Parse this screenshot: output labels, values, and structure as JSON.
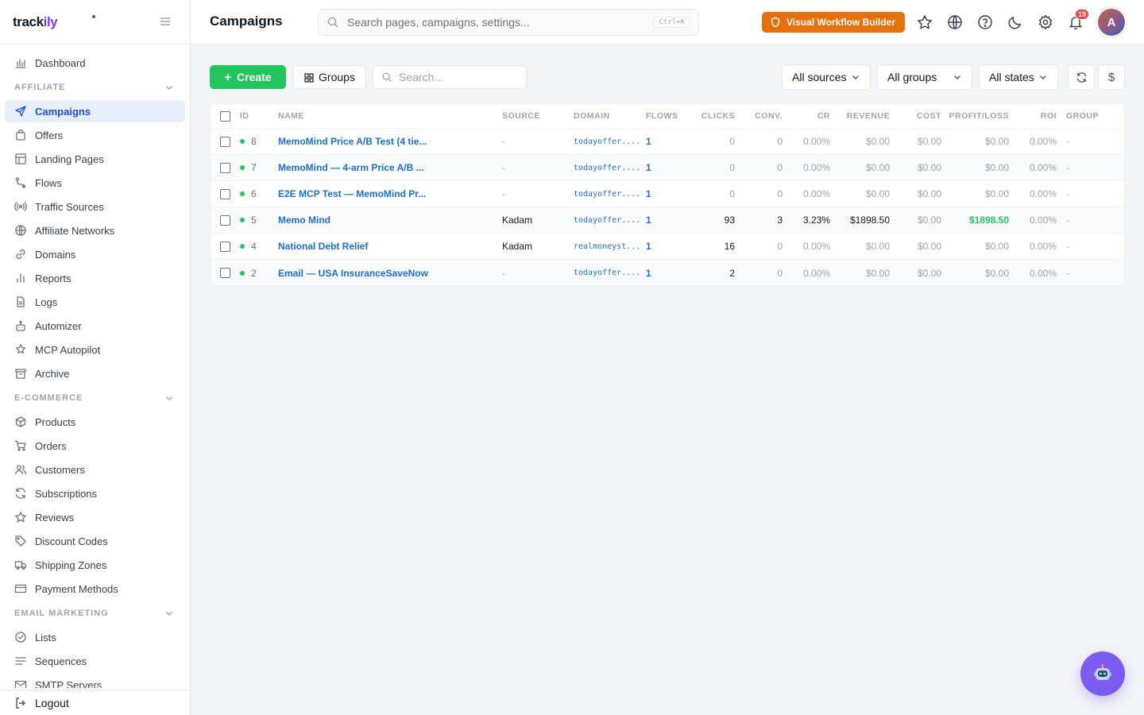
{
  "brand": {
    "name_a": "track",
    "name_b": "ily"
  },
  "sidebar": {
    "top": [
      {
        "label": "Dashboard",
        "icon": "chart-bar-icon"
      }
    ],
    "sections": [
      {
        "title": "AFFILIATE",
        "items": [
          {
            "label": "Campaigns",
            "icon": "send-icon",
            "active": true
          },
          {
            "label": "Offers",
            "icon": "bag-icon"
          },
          {
            "label": "Landing Pages",
            "icon": "layout-icon"
          },
          {
            "label": "Flows",
            "icon": "route-icon"
          },
          {
            "label": "Traffic Sources",
            "icon": "broadcast-icon"
          },
          {
            "label": "Affiliate Networks",
            "icon": "globe-icon"
          },
          {
            "label": "Domains",
            "icon": "link-icon"
          },
          {
            "label": "Reports",
            "icon": "bar-chart-icon"
          },
          {
            "label": "Logs",
            "icon": "file-icon"
          },
          {
            "label": "Automizer",
            "icon": "robot-icon"
          },
          {
            "label": "MCP Autopilot",
            "icon": "sparkle-icon"
          },
          {
            "label": "Archive",
            "icon": "archive-icon"
          }
        ]
      },
      {
        "title": "E-COMMERCE",
        "items": [
          {
            "label": "Products",
            "icon": "package-icon"
          },
          {
            "label": "Orders",
            "icon": "cart-icon"
          },
          {
            "label": "Customers",
            "icon": "users-icon"
          },
          {
            "label": "Subscriptions",
            "icon": "refresh-icon"
          },
          {
            "label": "Reviews",
            "icon": "star-icon"
          },
          {
            "label": "Discount Codes",
            "icon": "tag-icon"
          },
          {
            "label": "Shipping Zones",
            "icon": "truck-icon"
          },
          {
            "label": "Payment Methods",
            "icon": "card-icon"
          }
        ]
      },
      {
        "title": "EMAIL MARKETING",
        "items": [
          {
            "label": "Lists",
            "icon": "check-circle-icon"
          },
          {
            "label": "Sequences",
            "icon": "lines-icon"
          },
          {
            "label": "SMTP Servers",
            "icon": "mail-icon"
          }
        ]
      }
    ],
    "logout": "Logout"
  },
  "header": {
    "title": "Campaigns",
    "search_placeholder": "Search pages, campaigns, settings...",
    "shortcut": "Ctrl+K",
    "workflow_button": "Visual Workflow Builder",
    "notifications_count": "19",
    "avatar_initial": "A"
  },
  "toolbar": {
    "create_label": "Create",
    "groups_label": "Groups",
    "search_placeholder": "Search...",
    "sources_filter": "All sources",
    "groups_filter": "All groups",
    "states_filter": "All states"
  },
  "table": {
    "columns": [
      "ID",
      "NAME",
      "SOURCE",
      "DOMAIN",
      "FLOWS",
      "CLICKS",
      "CONV.",
      "CR",
      "REVENUE",
      "COST",
      "PROFIT/LOSS",
      "ROI",
      "GROUP"
    ],
    "rows": [
      {
        "id": "8",
        "name": "MemoMind Price A/B Test (4 tie...",
        "source": "-",
        "domain": "todayoffer....",
        "flows": "1",
        "clicks": "0",
        "conv": "0",
        "cr": "0.00%",
        "revenue": "$0.00",
        "cost": "$0.00",
        "profit": "$0.00",
        "roi": "0.00%",
        "group": "-"
      },
      {
        "id": "7",
        "name": "MemoMind — 4-arm Price A/B ...",
        "source": "-",
        "domain": "todayoffer....",
        "flows": "1",
        "clicks": "0",
        "conv": "0",
        "cr": "0.00%",
        "revenue": "$0.00",
        "cost": "$0.00",
        "profit": "$0.00",
        "roi": "0.00%",
        "group": "-"
      },
      {
        "id": "6",
        "name": "E2E MCP Test — MemoMind Pr...",
        "source": "-",
        "domain": "todayoffer....",
        "flows": "1",
        "clicks": "0",
        "conv": "0",
        "cr": "0.00%",
        "revenue": "$0.00",
        "cost": "$0.00",
        "profit": "$0.00",
        "roi": "0.00%",
        "group": "-"
      },
      {
        "id": "5",
        "name": "Memo Mind",
        "source": "Kadam",
        "domain": "todayoffer....",
        "flows": "1",
        "clicks": "93",
        "conv": "3",
        "cr": "3.23%",
        "revenue": "$1898.50",
        "cost": "$0.00",
        "profit": "$1898.50",
        "roi": "0.00%",
        "group": "-"
      },
      {
        "id": "4",
        "name": "National Debt Relief",
        "source": "Kadam",
        "domain": "realmoneyst...",
        "flows": "1",
        "clicks": "16",
        "conv": "0",
        "cr": "0.00%",
        "revenue": "$0.00",
        "cost": "$0.00",
        "profit": "$0.00",
        "roi": "0.00%",
        "group": "-"
      },
      {
        "id": "2",
        "name": "Email — USA InsuranceSaveNow",
        "source": "-",
        "domain": "todayoffer....",
        "flows": "1",
        "clicks": "2",
        "conv": "0",
        "cr": "0.00%",
        "revenue": "$0.00",
        "cost": "$0.00",
        "profit": "$0.00",
        "roi": "0.00%",
        "group": "-"
      }
    ]
  },
  "colors": {
    "accent": "#1d6ed8",
    "primary_green": "#22c55e",
    "workflow_orange": "#e8700c",
    "assistant_purple": "#7c5cf0"
  }
}
